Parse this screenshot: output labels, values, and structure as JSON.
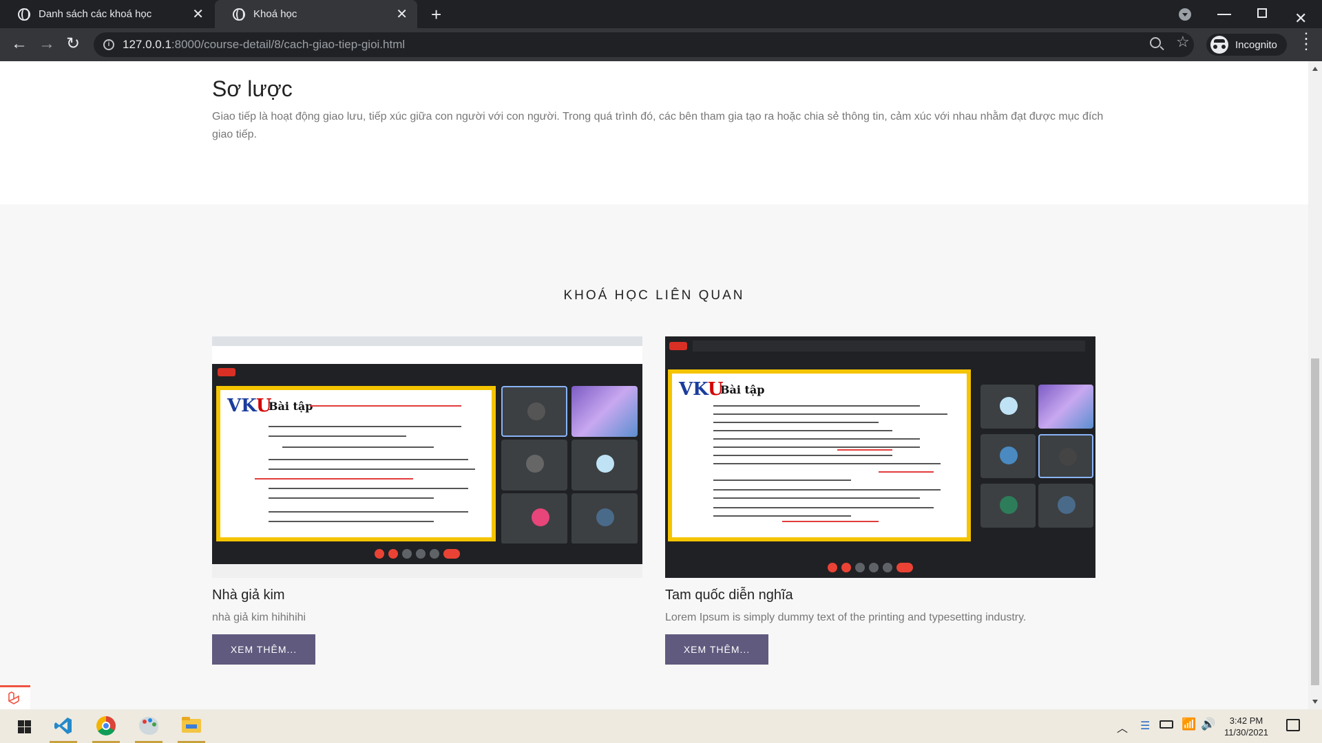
{
  "browser": {
    "tabs": [
      {
        "title": "Danh sách các khoá học",
        "active": false
      },
      {
        "title": "Khoá học",
        "active": true
      }
    ],
    "url_host": "127.0.0.1",
    "url_rest": ":8000/course-detail/8/cach-giao-tiep-gioi.html",
    "profile_label": "Incognito"
  },
  "summary": {
    "title": "Sơ lược",
    "text": "Giao tiếp là hoạt động giao lưu, tiếp xúc giữa con người với con người. Trong quá trình đó, các bên tham gia tạo ra hoặc chia sẻ thông tin, cảm xúc với nhau nhằm đạt được mục đích giao tiếp."
  },
  "related": {
    "heading": "KHOÁ HỌC LIÊN QUAN",
    "courses": [
      {
        "title": "Nhà giả kim",
        "description": "nhà giả kim hihihihi",
        "button_label": "XEM THÊM...",
        "thumbnail": {
          "logo_a": "VK",
          "logo_b": "U",
          "slide_title": "Bài tập"
        }
      },
      {
        "title": "Tam quốc diễn nghĩa",
        "description": "Lorem Ipsum is simply dummy text of the printing and typesetting industry.",
        "button_label": "XEM THÊM...",
        "thumbnail": {
          "logo_a": "VK",
          "logo_b": "U",
          "slide_title": "Bài tập"
        }
      }
    ]
  },
  "taskbar": {
    "time": "3:42 PM",
    "date": "11/30/2021",
    "apps": [
      "vscode-icon",
      "chrome-icon",
      "paint-icon",
      "file-explorer-icon"
    ]
  },
  "colors": {
    "button_bg": "#5f5a7e",
    "related_bg": "#f7f7f7",
    "chrome_dark": "#202124",
    "chrome_toolbar": "#35363a"
  }
}
